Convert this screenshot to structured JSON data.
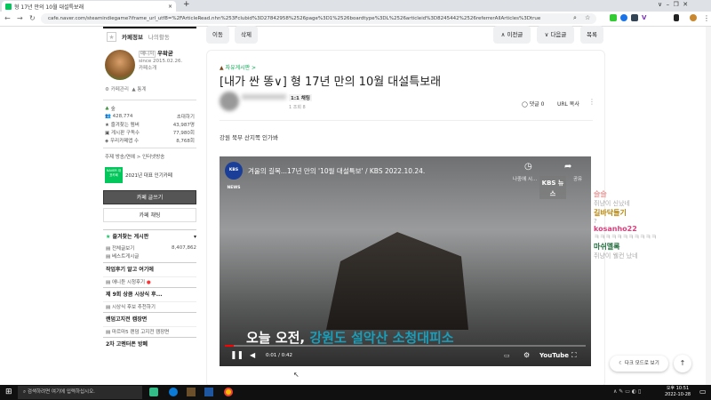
{
  "browser": {
    "tab_title": "형 17년 만의 10월 대설특보래",
    "url": "cafe.naver.com/steamindiegame?iframe_url_utf8=%2FArticleRead.nhn%253Fclubid%3D27842958%2526page%3D1%2526boardtype%3DL%2526articleid%3D8245442%2526referrerAllArticles%3Dtrue"
  },
  "sidebar": {
    "tab_info": "카페정보",
    "tab_activity": "나의활동",
    "manager_badge": "매니저",
    "manager": "우왁굳",
    "since": "since 2015.02.26.",
    "cafe_intro": "카페소개",
    "manage": "카페관리",
    "stats": "통계",
    "level": "숲",
    "members": "428,774",
    "invite": "초대하기",
    "rows": [
      {
        "label": "즐겨찾는 멤버",
        "value": "43,987명"
      },
      {
        "label": "게시판 구독수",
        "value": "77,980회"
      },
      {
        "label": "우리카페앱 수",
        "value": "8,768회"
      }
    ],
    "topic": "주제 방송/연예 > 인터넷방송",
    "naver_badge": "NAVER 대표카페",
    "award": "2021년 대표 인기카페",
    "write": "카페 글쓰기",
    "chat": "카페 채팅",
    "fav_boards": "즐겨찾는 게시판",
    "items": [
      {
        "label": "전체글보기",
        "count": "8,407,862"
      },
      {
        "label": "베스트게시글"
      }
    ],
    "sections": [
      {
        "title": "작업후기 알고 여기에",
        "items": [
          "애니듣 시청후기"
        ]
      },
      {
        "title": "제 9회 상큼 시상식 후...",
        "items": [
          "시상식 후보 추천하기"
        ]
      },
      {
        "title": "랜덤고지전 캠장면",
        "items": [
          "마르마5 랜덤 고지전 캠장면"
        ]
      },
      {
        "title": "2차 고멘터폰 방폐",
        "items": []
      }
    ]
  },
  "toolbar": {
    "move": "이동",
    "delete": "삭제",
    "prev": "이전글",
    "next": "다음글",
    "list": "목록"
  },
  "article": {
    "board": "자유게시판 >",
    "title": "[내가 싼 똥∨] 형 17년 만의 10월 대설특보래",
    "chat_badge": "1:1 채팅",
    "views": "1  조회 8",
    "comments": "댓글 0",
    "url_copy": "URL 복사",
    "body": "강원 북부 산지쪽 인가봐"
  },
  "video": {
    "channel": "KBS NEWS",
    "title": "겨울의 길목...17년 만의 '10월 대설특보' / KBS 2022.10.24.",
    "watch_later": "나중에 시...",
    "share": "공유",
    "watermark": "KBS 뉴스",
    "caption_white": "오늘 오전, ",
    "caption_blue": "강원도 설악산 소청대피소",
    "time": "0:01 / 0:42",
    "progress": 0.024,
    "youtube": "YouTube"
  },
  "chat": [
    {
      "name": "슬슬",
      "msg": "쥐냥이 신났네",
      "color": "#e8a0a0"
    },
    {
      "name": "길바닥들기",
      "msg": "?",
      "color": "#b8860b"
    },
    {
      "name": "kosanho22",
      "msg": "ㅋㅋㅋㅋㅋㅋㅋㅋㅋㅋㅋ",
      "color": "#d6417a"
    },
    {
      "name": "마쉬멜록",
      "msg": "쥐냥이 웰컨 났네",
      "color": "#1f6b3a"
    }
  ],
  "floating": {
    "dark_mode": "다크 모드로 보기"
  },
  "taskbar": {
    "search": "검색하려면 여기에 입력하십시오.",
    "time": "오후 10:51",
    "date": "2022-10-28"
  }
}
